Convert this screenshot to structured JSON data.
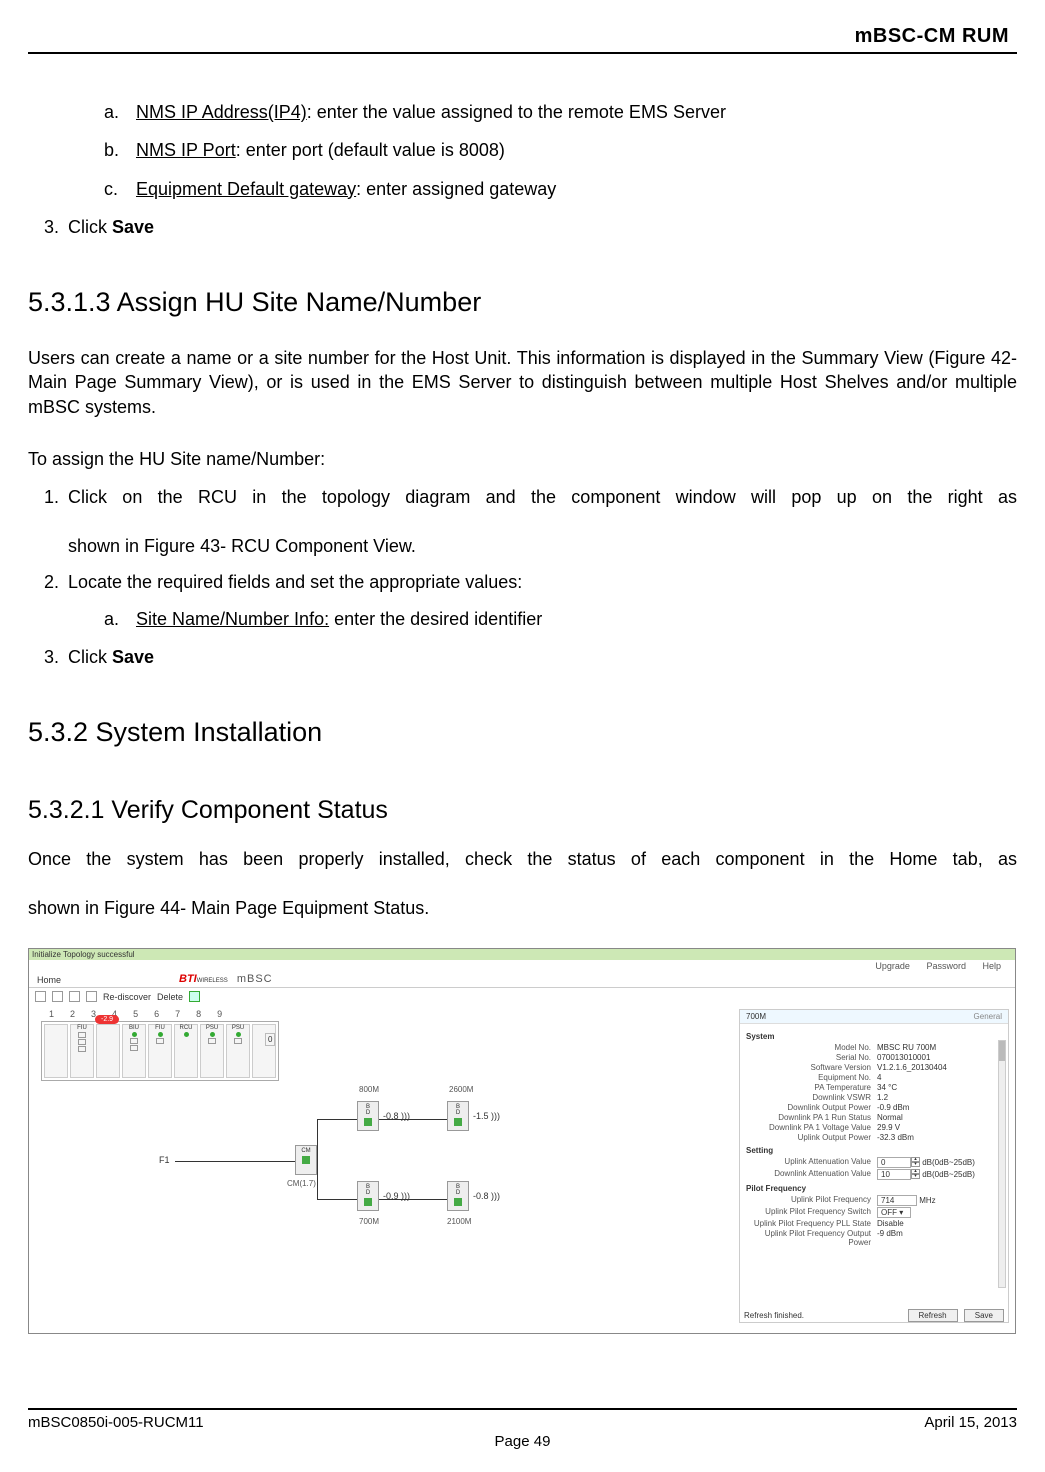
{
  "header": {
    "title": "mBSC-CM   RUM"
  },
  "list_a": {
    "a_label": "NMS IP Address(IP4)",
    "a_text": ": enter the value assigned to the remote EMS Server",
    "b_label": "NMS IP Port",
    "b_text": ": enter port (default value is 8008)",
    "c_label": "Equipment Default gateway",
    "c_text": ": enter assigned gateway"
  },
  "step3": {
    "pre": "Click ",
    "bold": "Save"
  },
  "sec5313_title": "5.3.1.3    Assign HU Site Name/Number",
  "sec5313_para": "Users can create a name or a site number for the Host Unit. This information is displayed in the Summary View (Figure 42- Main Page Summary View), or is used in the EMS Server to distinguish between multiple Host Shelves and/or multiple mBSC systems.",
  "sec5313_intro": "To assign the HU Site name/Number:",
  "sec5313_s1_l1": "Click on the RCU in the topology diagram and the component window will pop up on the right as",
  "sec5313_s1_l2": "shown in Figure 43- RCU Component View.",
  "sec5313_s2": "Locate the required fields and set the appropriate values:",
  "sec5313_s2a_label": "Site Name/Number Info:",
  "sec5313_s2a_text": " enter the desired identifier",
  "sec532_title": "5.3.2  System Installation",
  "sec5321_title": "5.3.2.1    Verify Component Status",
  "sec5321_para_l1": "Once the system has been properly installed, check the status of each component in the Home tab, as",
  "sec5321_para_l2": "shown in Figure 44- Main Page Equipment Status.",
  "figure": {
    "green_text": "Initialize Topology successful",
    "top_menu": [
      "Upgrade",
      "Password",
      "Help"
    ],
    "home": "Home",
    "toolbar_rediscover": "Re-discover",
    "toolbar_delete": "Delete",
    "logo_bti": "BTI",
    "logo_mbsc": "mBSC",
    "slot_nums": [
      1,
      2,
      3,
      4,
      5,
      6,
      7,
      8,
      9
    ],
    "slot_labels": [
      "",
      "FIU",
      "",
      "BIU",
      "FIU",
      "RCU",
      "PSU",
      "PSU",
      ""
    ],
    "tag": "-2.9",
    "zero_box": "0",
    "f1": "F1",
    "nodes": {
      "cm": {
        "label": "CM",
        "sub": "CM(1.7)"
      },
      "n800": {
        "label": "800M",
        "v": "-0.8"
      },
      "n2600": {
        "label": "2600M",
        "v": "-1.5"
      },
      "n700": {
        "label": "700M",
        "v": "-0.9"
      },
      "n2100": {
        "label": "2100M",
        "v": "-0.8"
      }
    },
    "panel": {
      "tab": "700M",
      "tab2": "General",
      "sec_system": "System",
      "rows_system": [
        {
          "k": "Model No.",
          "v": "MBSC RU 700M"
        },
        {
          "k": "Serial No.",
          "v": "070013010001"
        },
        {
          "k": "Software Version",
          "v": "V1.2.1.6_20130404"
        },
        {
          "k": "Equipment No.",
          "v": "4"
        },
        {
          "k": "PA Temperature",
          "v": "34  °C"
        },
        {
          "k": "Downlink VSWR",
          "v": "1.2"
        },
        {
          "k": "Downlink Output Power",
          "v": "-0.9  dBm"
        },
        {
          "k": "Downlink PA 1 Run Status",
          "v": "Normal"
        },
        {
          "k": "Downlink PA 1 Voltage Value",
          "v": "29.9  V"
        },
        {
          "k": "Uplink Output Power",
          "v": "-32.3  dBm"
        }
      ],
      "sec_setting": "Setting",
      "rows_setting": [
        {
          "k": "Uplink Attenuation Value",
          "v": "0",
          "suffix": "dB(0dB~25dB)"
        },
        {
          "k": "Downlink Attenuation Value",
          "v": "10",
          "suffix": "dB(0dB~25dB)"
        }
      ],
      "sec_pilot": "Pilot Frequency",
      "rows_pilot": [
        {
          "k": "Uplink Pilot Frequency",
          "v": "714",
          "suffix": "MHz"
        },
        {
          "k": "Uplink Pilot Frequency Switch",
          "v": "OFF"
        },
        {
          "k": "Uplink Pilot Frequency PLL State",
          "v": "Disable"
        },
        {
          "k": "Uplink Pilot Frequency Output Power",
          "v": "-9  dBm"
        }
      ],
      "status": "Refresh finished.",
      "btn_refresh": "Refresh",
      "btn_save": "Save"
    }
  },
  "footer": {
    "left": "mBSC0850i-005-RUCM11",
    "right": "April 15, 2013",
    "page": "Page 49"
  }
}
